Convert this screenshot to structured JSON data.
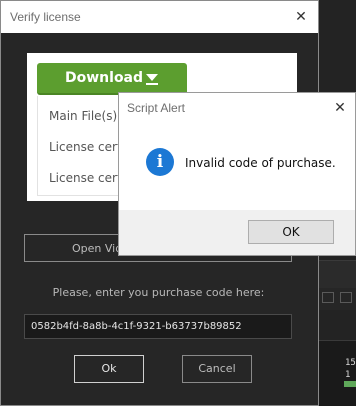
{
  "main_dialog": {
    "title": "Verify license",
    "close_glyph": "✕",
    "download_label": "Download",
    "menu_items": [
      "Main File(s)",
      "License certificate",
      "License certificate"
    ],
    "open_video_label": "Open Video",
    "prompt": "Please, enter you purchase code here:",
    "purchase_code": "0582b4fd-8a8b-4c1f-9321-b63737b89852",
    "ok_label": "Ok",
    "cancel_label": "Cancel"
  },
  "alert": {
    "title": "Script Alert",
    "close_glyph": "✕",
    "icon_glyph": "i",
    "message": "Invalid code of purchase.",
    "ok_label": "OK"
  },
  "background_app": {
    "timecode_1": "15",
    "timecode_2": "1"
  },
  "colors": {
    "download_green": "#5c9e2f",
    "info_blue": "#1c78d4",
    "dialog_bg": "#262626"
  }
}
